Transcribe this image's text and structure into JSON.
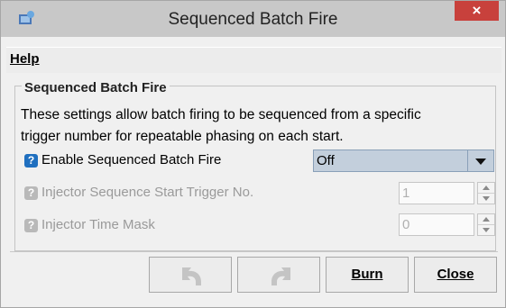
{
  "window": {
    "title": "Sequenced Batch Fire",
    "close_label": "×"
  },
  "menu": {
    "help_label": "Help"
  },
  "group": {
    "title": "Sequenced Batch Fire",
    "description_line1": "These settings allow batch firing to be sequenced from a specific",
    "description_line2": "trigger number for repeatable phasing on each start."
  },
  "settings": [
    {
      "label": "Enable Sequenced Batch Fire",
      "value": "Off",
      "enabled": true
    },
    {
      "label": "Injector Sequence Start Trigger No.",
      "value": "1",
      "enabled": false
    },
    {
      "label": "Injector Time Mask",
      "value": "0",
      "enabled": false
    }
  ],
  "buttons": {
    "burn_label": "Burn",
    "close_label": "Close"
  },
  "icons": {
    "help_enabled": "help-icon",
    "help_disabled": "help-icon-disabled",
    "undo": "undo-icon",
    "redo": "redo-icon"
  },
  "colors": {
    "close_button": "#c8413c",
    "help_icon": "#1f6fbf",
    "select_bg": "#c3cfdc",
    "disabled_text": "#9a9a9a"
  }
}
